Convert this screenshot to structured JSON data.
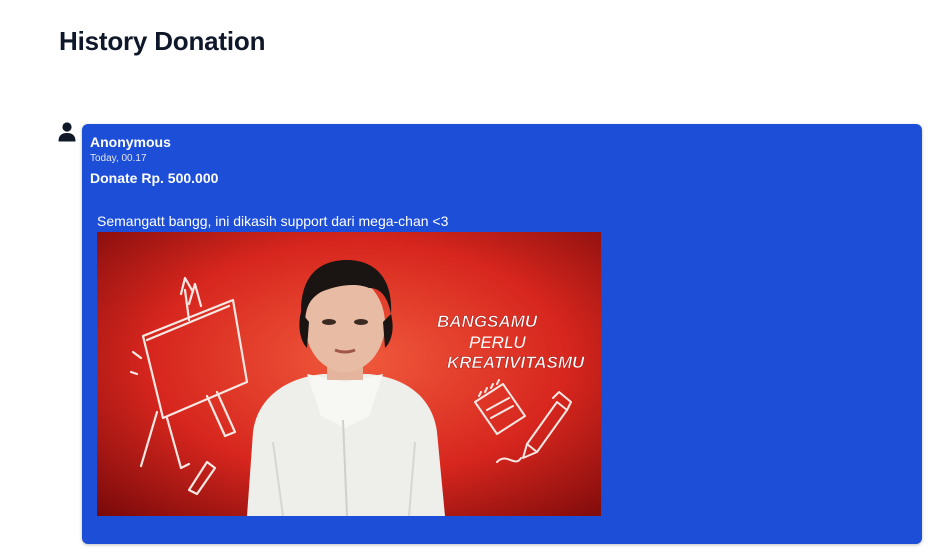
{
  "header": {
    "title": "History Donation"
  },
  "donation": {
    "donor_icon": "user-icon",
    "donor_name": "Anonymous",
    "time": "Today, 00.17",
    "amount": "Donate Rp. 500.000",
    "message": "Semangatt bangg, ini dikasih support dari mega-chan <3",
    "media": {
      "line1": "BANGSAMU",
      "line2": "PERLU",
      "line3": "KREATIVITASMU"
    }
  },
  "colors": {
    "card": "#1d4ed8",
    "media_bg": "#d7261e"
  }
}
